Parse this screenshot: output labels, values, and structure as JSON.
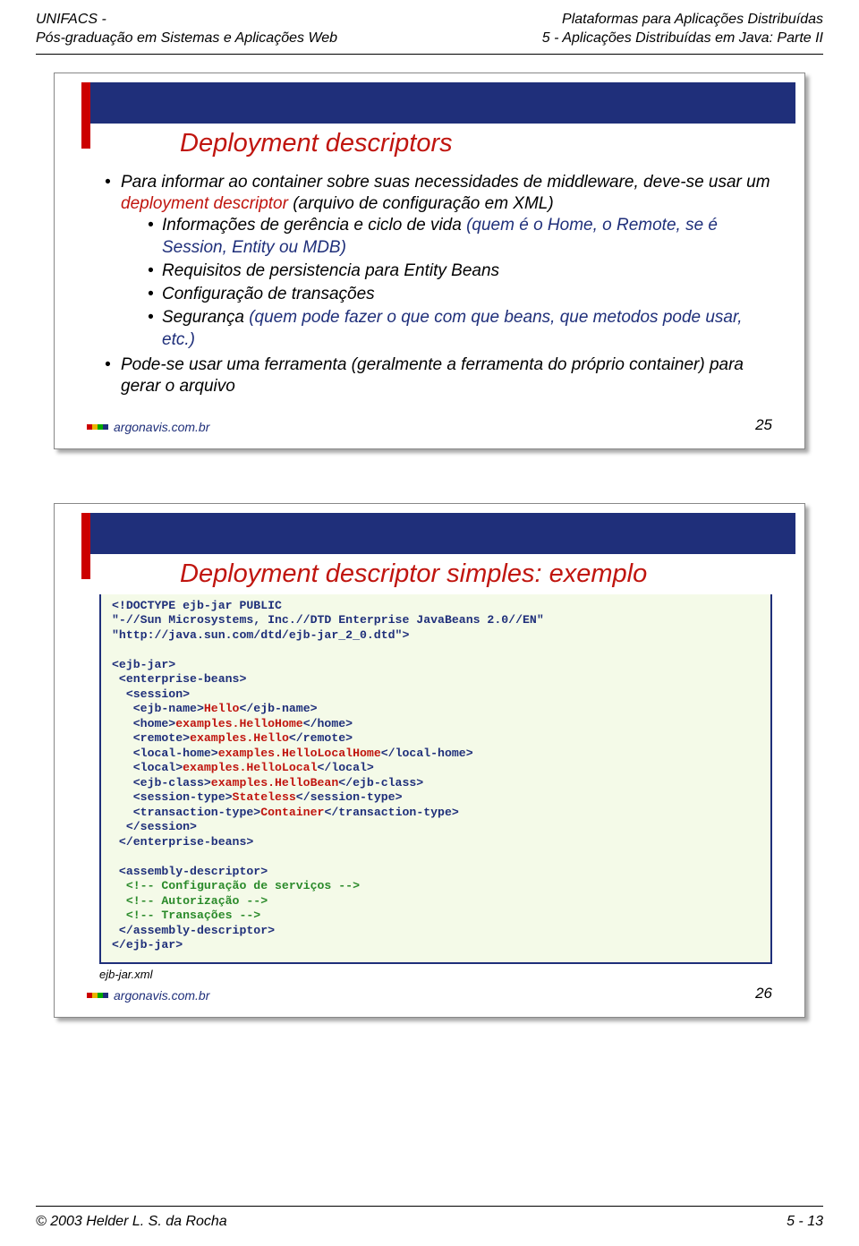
{
  "header": {
    "left_line1": "UNIFACS -",
    "left_line2": "Pós-graduação em Sistemas e Aplicações Web",
    "right_line1": "Plataformas para Aplicações Distribuídas",
    "right_line2": "5 - Aplicações Distribuídas em Java: Parte II"
  },
  "slide1": {
    "title": "Deployment descriptors",
    "b1_1_a": "Para informar ao container sobre suas necessidades de middleware, deve-se usar um ",
    "b1_1_b_red": "deployment descriptor",
    "b1_1_c": " (arquivo de configuração em XML)",
    "b2_1_a": "Informações de gerência e ciclo de vida ",
    "b2_1_b": "(quem é o Home, o Remote, se é Session, Entity ou MDB)",
    "b2_2": "Requisitos de persistencia para Entity Beans",
    "b2_3": "Configuração de transações",
    "b2_4_a": "Segurança ",
    "b2_4_b": "(quem pode fazer o que com que beans, que metodos pode usar, etc.)",
    "b1_2": "Pode-se usar uma ferramenta (geralmente a ferramenta do próprio container) para gerar o arquivo",
    "footer_brand": "argonavis.com.br",
    "page_num": "25"
  },
  "slide2": {
    "title": "Deployment descriptor simples: exemplo",
    "code": {
      "l1": "<!DOCTYPE ejb-jar PUBLIC",
      "l2": "\"-//Sun Microsystems, Inc.//DTD Enterprise JavaBeans 2.0//EN\"",
      "l3": "\"http://java.sun.com/dtd/ejb-jar_2_0.dtd\">",
      "l4": "<ejb-jar>",
      "l5": " <enterprise-beans>",
      "l6": "  <session>",
      "l7a": "   <ejb-name>",
      "l7b": "Hello",
      "l7c": "</ejb-name>",
      "l8a": "   <home>",
      "l8b": "examples.HelloHome",
      "l8c": "</home>",
      "l9a": "   <remote>",
      "l9b": "examples.Hello",
      "l9c": "</remote>",
      "l10a": "   <local-home>",
      "l10b": "examples.HelloLocalHome",
      "l10c": "</local-home>",
      "l11a": "   <local>",
      "l11b": "examples.HelloLocal",
      "l11c": "</local>",
      "l12a": "   <ejb-class>",
      "l12b": "examples.HelloBean",
      "l12c": "</ejb-class>",
      "l13a": "   <session-type>",
      "l13b": "Stateless",
      "l13c": "</session-type>",
      "l14a": "   <transaction-type>",
      "l14b": "Container",
      "l14c": "</transaction-type>",
      "l15": "  </session>",
      "l16": " </enterprise-beans>",
      "l17": " <assembly-descriptor>",
      "l18": "  <!-- Configuração de serviços -->",
      "l19": "  <!-- Autorização -->",
      "l20": "  <!-- Transações -->",
      "l21": " </assembly-descriptor>",
      "l22": "</ejb-jar>"
    },
    "caption": "ejb-jar.xml",
    "footer_brand": "argonavis.com.br",
    "page_num": "26"
  },
  "footer": {
    "left": "© 2003 Helder L. S. da Rocha",
    "right": "5 - 13"
  }
}
